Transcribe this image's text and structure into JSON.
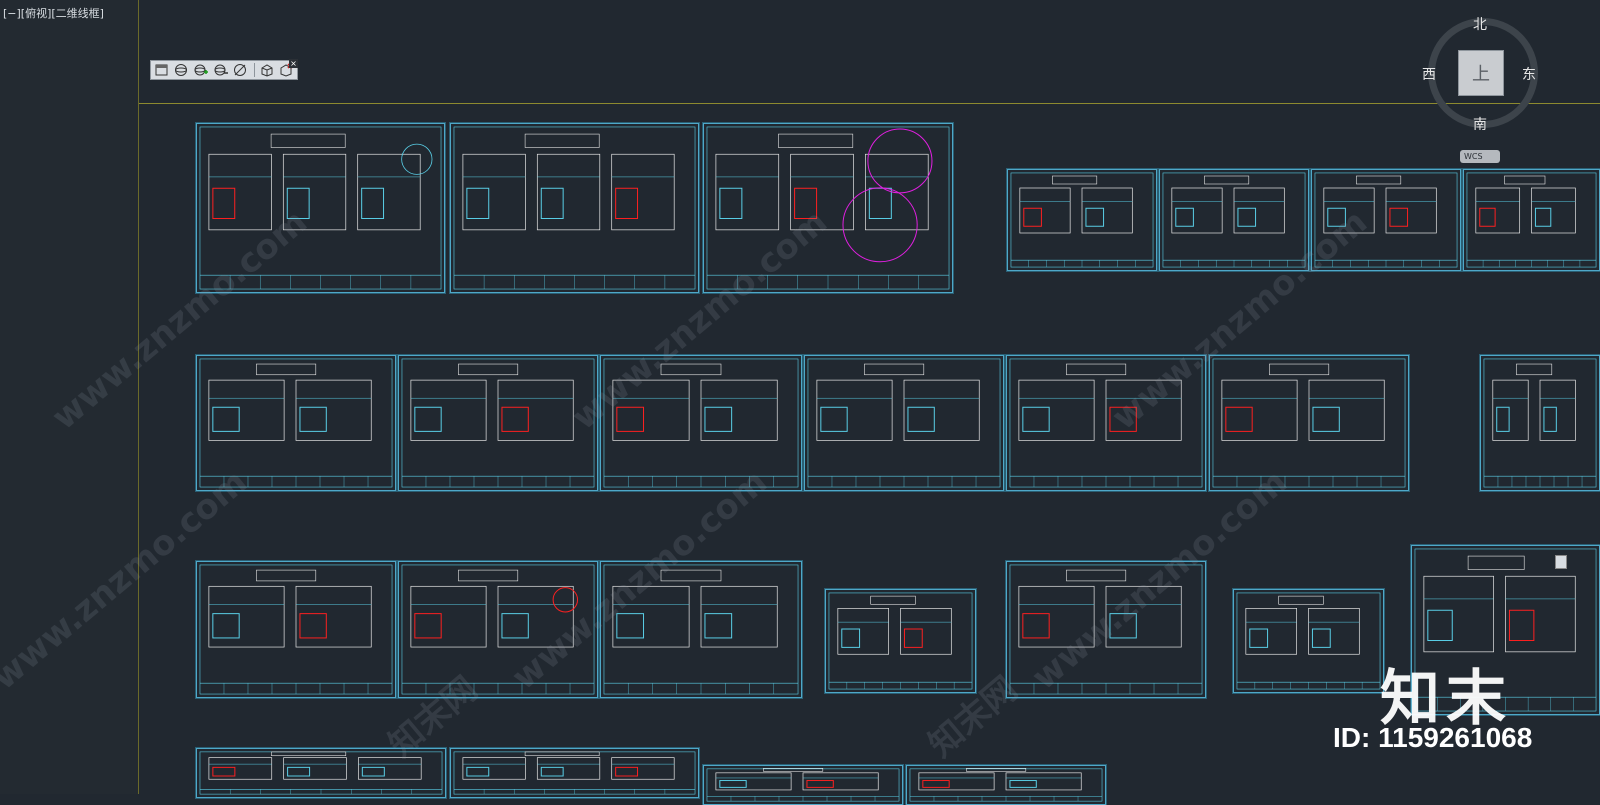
{
  "viewport": {
    "label": "[−][俯视][二维线框]"
  },
  "toolbar": {
    "buttons": [
      "view-manager",
      "orbit",
      "orbit-add",
      "orbit-zoom",
      "orbit-remove",
      "camera",
      "camera-close"
    ],
    "close_label": "×"
  },
  "viewcube": {
    "north": "北",
    "south": "南",
    "west": "西",
    "east": "东",
    "face": "上",
    "wcs": "WCS"
  },
  "colors": {
    "background": "#212830",
    "sheet_border": "#4fa8c8",
    "cyan": "#5ad0e8",
    "red": "#ff2020",
    "magenta": "#e020e0",
    "white": "#e8e8e8",
    "yellow": "#c8c020"
  },
  "watermarks": {
    "site": "www.znzmo.com",
    "brand": "知末网",
    "logo": "知末",
    "id": "ID: 1159261068"
  }
}
